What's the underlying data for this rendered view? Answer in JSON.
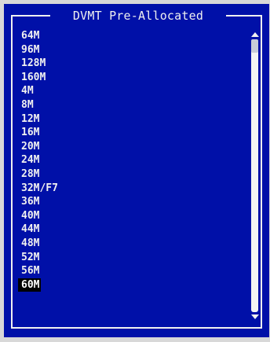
{
  "dialog": {
    "title": "DVMT Pre-Allocated",
    "options": [
      "64M",
      "96M",
      "128M",
      "160M",
      "4M",
      "8M",
      "12M",
      "16M",
      "20M",
      "24M",
      "28M",
      "32M/F7",
      "36M",
      "40M",
      "44M",
      "48M",
      "52M",
      "56M",
      "60M"
    ],
    "selected_index": 18
  },
  "colors": {
    "background": "#0010a8",
    "text": "#f0f0f0",
    "highlight": "#000000",
    "outer_frame": "#d8d8d8"
  },
  "icons": {
    "scroll_up": "triangle-up",
    "scroll_down": "triangle-down"
  }
}
